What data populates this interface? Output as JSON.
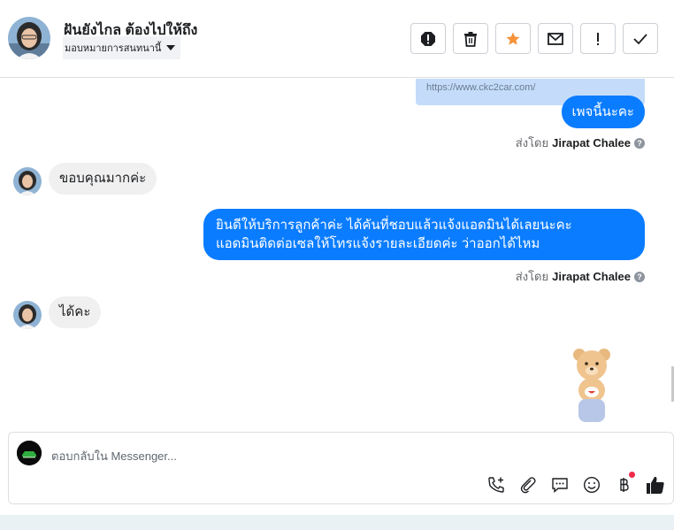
{
  "header": {
    "title": "ฝันยังไกล ต้องไปให้ถึง",
    "assign_label": "มอบหมายการสนทนานี้"
  },
  "toolbar": {
    "buttons": [
      "spam-icon",
      "trash-icon",
      "star-icon",
      "envelope-icon",
      "exclamation-icon",
      "check-icon"
    ],
    "star_color": "#f7923b"
  },
  "messages": {
    "link_url": "https://www.ckc2car.com/",
    "out1": "เพจนี้นะคะ",
    "sent_prefix": "ส่งโดย",
    "sender": "Jirapat Chalee",
    "in1": "ขอบคุณมากค่ะ",
    "out2_line1": "ยินดีให้บริการลูกค้าค่ะ ได้คันที่ชอบแล้วแจ้งแอดมินได้เลยนะคะ",
    "out2_line2": "แอดมินติดต่อเซลให้โทรแจ้งรายละเอียดค่ะ ว่าออกได้ไหม",
    "in2": "ได้คะ",
    "sticker": "teddy-bear-sticker"
  },
  "composer": {
    "placeholder": "ตอบกลับใน Messenger...",
    "icons": [
      "phone-plus-icon",
      "paperclip-icon",
      "saved-reply-icon",
      "emoji-icon",
      "baht-icon",
      "thumbs-up-icon"
    ]
  },
  "colors": {
    "outgoing_bubble": "#0a7cff",
    "incoming_bubble": "#f0f0f0",
    "link_preview": "#c4dcfa"
  }
}
